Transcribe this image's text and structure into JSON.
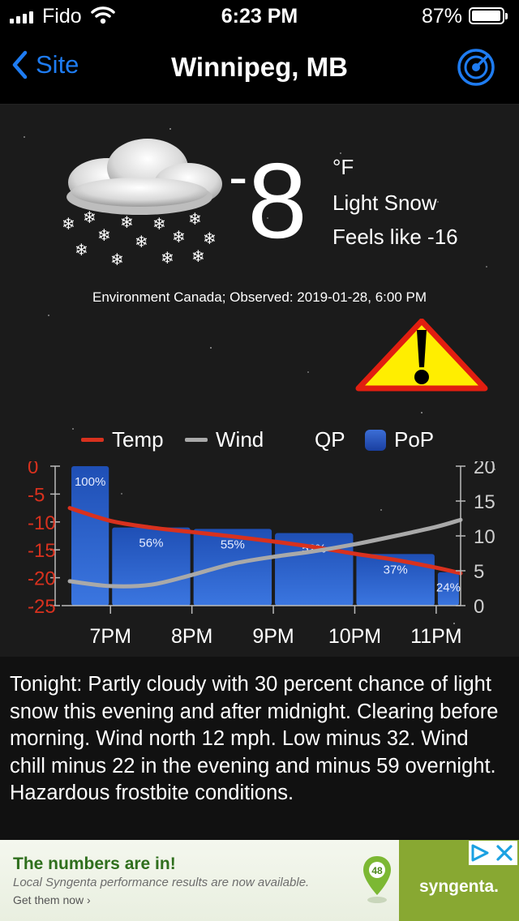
{
  "status_bar": {
    "carrier": "Fido",
    "time": "6:23 PM",
    "battery_percent": "87%",
    "battery_level": 0.87,
    "signal_bars": 4
  },
  "nav": {
    "back_label": "Site",
    "title": "Winnipeg, MB",
    "back_icon": "chevron-left-icon",
    "radar_icon": "radar-icon",
    "accent": "#1e7cf2"
  },
  "current": {
    "temp_sign": "-",
    "temp_value": "8",
    "unit": "°F",
    "condition": "Light Snow",
    "feels_like": "Feels like -16",
    "observed": "Environment Canada; Observed: 2019-01-28, 6:00 PM",
    "condition_icon": "snow-cloud-icon",
    "warning_icon": "warning-triangle-icon"
  },
  "legend": {
    "temp": "Temp",
    "wind": "Wind",
    "qp": "QP",
    "pop": "PoP"
  },
  "chart_data": {
    "type": "bar",
    "x": [
      "6:30PM",
      "7PM",
      "7:30PM",
      "8PM",
      "8:30PM",
      "9PM",
      "9:30PM",
      "10PM",
      "10:30PM",
      "11PM",
      "11:30PM"
    ],
    "categories": [
      "7PM",
      "8PM",
      "9PM",
      "10PM",
      "11PM"
    ],
    "pop_bars": [
      {
        "start": 6.5,
        "end": 7.0,
        "value": 100,
        "label": "100%"
      },
      {
        "start": 7.0,
        "end": 8.0,
        "value": 56,
        "label": "56%"
      },
      {
        "start": 8.0,
        "end": 9.0,
        "value": 55,
        "label": "55%"
      },
      {
        "start": 9.0,
        "end": 10.0,
        "value": 52,
        "label": "52%"
      },
      {
        "start": 10.0,
        "end": 11.0,
        "value": 37,
        "label": "37%"
      },
      {
        "start": 11.0,
        "end": 11.3,
        "value": 24,
        "label": "24%"
      }
    ],
    "series": [
      {
        "name": "Temp",
        "color": "#d8311e",
        "axis": "left",
        "points": [
          [
            6.5,
            -7.5
          ],
          [
            7.0,
            -9.8
          ],
          [
            7.5,
            -11.0
          ],
          [
            8.0,
            -11.8
          ],
          [
            8.5,
            -12.6
          ],
          [
            9.0,
            -13.5
          ],
          [
            9.5,
            -14.5
          ],
          [
            10.0,
            -15.7
          ],
          [
            10.5,
            -16.8
          ],
          [
            11.0,
            -18.2
          ],
          [
            11.3,
            -19.2
          ]
        ]
      },
      {
        "name": "Wind",
        "color": "#a9a9a9",
        "axis": "right",
        "points": [
          [
            6.5,
            3.5
          ],
          [
            7.0,
            2.8
          ],
          [
            7.5,
            3.0
          ],
          [
            8.0,
            4.4
          ],
          [
            8.5,
            6.0
          ],
          [
            9.0,
            7.0
          ],
          [
            9.5,
            7.8
          ],
          [
            10.0,
            8.8
          ],
          [
            10.5,
            10.0
          ],
          [
            11.0,
            11.3
          ],
          [
            11.3,
            12.3
          ]
        ]
      }
    ],
    "left_axis": {
      "ticks": [
        "0",
        "-5",
        "-10",
        "-15",
        "-20",
        "-25"
      ],
      "min": -25,
      "max": 0,
      "color": "#d8311e"
    },
    "right_axis": {
      "ticks": [
        "20",
        "15",
        "10",
        "5",
        "0"
      ],
      "min": 0,
      "max": 20,
      "color": "#cfcfcf"
    },
    "x_range": [
      6.4,
      11.3
    ],
    "x_ticks": [
      7,
      8,
      9,
      10,
      11
    ],
    "bar_color": "#2a5cc8"
  },
  "forecast_text": "Tonight:  Partly cloudy with 30 percent chance of light snow this evening and after midnight. Clearing before morning. Wind north 12 mph. Low minus 32. Wind chill minus 22 in the evening and minus 59 overnight. Hazardous frostbite conditions.",
  "ad": {
    "headline": "The numbers are in!",
    "subline": "Local Syngenta performance results are now available.",
    "cta": "Get them now ›",
    "pin_number": "48",
    "brand": "syngenta.",
    "adchoices_icon": "adchoices-icon",
    "close_icon": "close-icon",
    "brand_color": "#88a832"
  }
}
